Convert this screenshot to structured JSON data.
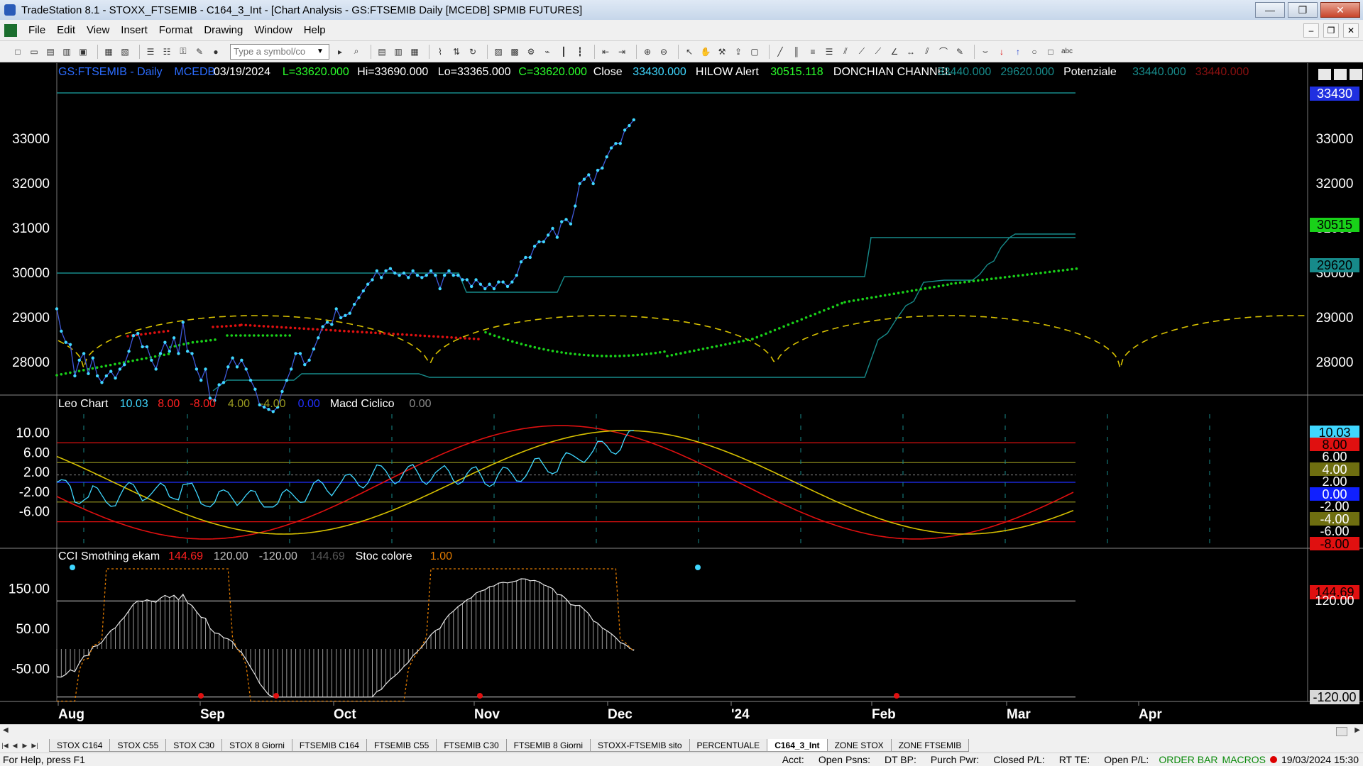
{
  "window": {
    "title": "TradeStation 8.1 - STOXX_FTSEMIB - C164_3_Int - [Chart Analysis - GS:FTSEMIB  Daily  [MCEDB] SPMIB FUTURES]",
    "minimize": "—",
    "maximize": "❐",
    "close": "✕"
  },
  "menu": {
    "items": [
      "File",
      "Edit",
      "View",
      "Insert",
      "Format",
      "Drawing",
      "Window",
      "Help"
    ]
  },
  "toolbar": {
    "symbol_placeholder": "Type a symbol/co"
  },
  "price_panel": {
    "header": [
      {
        "text": "GS:FTSEMIB - Daily",
        "color": "#2b6cff"
      },
      {
        "text": "MCEDB",
        "color": "#2b6cff"
      },
      {
        "text": "03/19/2024",
        "color": "#ffffff"
      },
      {
        "text": "L=33620.000",
        "color": "#2bff2b"
      },
      {
        "text": "Hi=33690.000",
        "color": "#ffffff"
      },
      {
        "text": "Lo=33365.000",
        "color": "#ffffff"
      },
      {
        "text": "C=33620.000",
        "color": "#2bff2b"
      },
      {
        "text": "Close",
        "color": "#ffffff"
      },
      {
        "text": "33430.000",
        "color": "#3fd7ff"
      },
      {
        "text": "HILOW Alert",
        "color": "#ffffff"
      },
      {
        "text": "30515.118",
        "color": "#2bff2b"
      },
      {
        "text": "DONCHIAN CHANNEL",
        "color": "#ffffff"
      },
      {
        "text": "33440.000",
        "color": "#178a8a"
      },
      {
        "text": "29620.000",
        "color": "#178a8a"
      },
      {
        "text": "Potenziale",
        "color": "#ffffff"
      },
      {
        "text": "33440.000",
        "color": "#178a8a"
      },
      {
        "text": "33440.000",
        "color": "#8a1010"
      }
    ],
    "y_ticks": [
      "33000",
      "32000",
      "31000",
      "30000",
      "29000",
      "28000"
    ],
    "y_tick_values": [
      33000,
      32000,
      31000,
      30000,
      29000,
      28000
    ],
    "badges": [
      {
        "text": "33430",
        "bg": "#1f2fe0",
        "fg": "#ffffff"
      },
      {
        "text": "30515",
        "bg": "#19d119",
        "fg": "#000000"
      },
      {
        "text": "29620",
        "bg": "#178a8a",
        "fg": "#000000"
      }
    ]
  },
  "leo_panel": {
    "header": [
      {
        "text": "Leo Chart",
        "color": "#ffffff"
      },
      {
        "text": "10.03",
        "color": "#3fd7ff"
      },
      {
        "text": "8.00",
        "color": "#ff2020"
      },
      {
        "text": "-8.00",
        "color": "#ff2020"
      },
      {
        "text": "4.00",
        "color": "#9a9a20"
      },
      {
        "text": "-4.00",
        "color": "#9a9a20"
      },
      {
        "text": "0.00",
        "color": "#2030ff"
      },
      {
        "text": "Macd Ciclico",
        "color": "#ffffff"
      },
      {
        "text": "0.00",
        "color": "#8a8a8a"
      }
    ],
    "y_ticks": [
      "10.00",
      "6.00",
      "2.00",
      "-2.00",
      "-6.00"
    ],
    "y_tick_values": [
      10,
      6,
      2,
      -2,
      -6
    ],
    "badges": [
      {
        "text": "10.03",
        "bg": "#3fd7ff",
        "fg": "#000000"
      },
      {
        "text": "8.00",
        "bg": "#e01010",
        "fg": "#000000"
      },
      {
        "text": "6.00",
        "bg": "",
        "fg": "#ffffff"
      },
      {
        "text": "4.00",
        "bg": "#6e6e10",
        "fg": "#ffffff"
      },
      {
        "text": "2.00",
        "bg": "",
        "fg": "#ffffff"
      },
      {
        "text": "0.00",
        "bg": "#1020ff",
        "fg": "#ffffff"
      },
      {
        "text": "-2.00",
        "bg": "",
        "fg": "#ffffff"
      },
      {
        "text": "-4.00",
        "bg": "#6e6e10",
        "fg": "#ffffff"
      },
      {
        "text": "-6.00",
        "bg": "",
        "fg": "#ffffff"
      },
      {
        "text": "-8.00",
        "bg": "#e01010",
        "fg": "#000000"
      }
    ]
  },
  "cci_panel": {
    "header": [
      {
        "text": "CCI Smothing ekam",
        "color": "#ffffff"
      },
      {
        "text": "144.69",
        "color": "#ff2020"
      },
      {
        "text": "120.00",
        "color": "#c0c0c0"
      },
      {
        "text": "-120.00",
        "color": "#c0c0c0"
      },
      {
        "text": "144.69",
        "color": "#555555"
      },
      {
        "text": "Stoc colore",
        "color": "#ffffff"
      },
      {
        "text": "1.00",
        "color": "#e07a00"
      }
    ],
    "y_ticks": [
      "150.00",
      "50.00",
      "-50.00"
    ],
    "y_tick_values": [
      150,
      50,
      -50
    ],
    "badges": [
      {
        "text": "144.69",
        "bg": "#e01010",
        "fg": "#000000"
      },
      {
        "text": "120.00",
        "bg": "",
        "fg": "#ffffff"
      },
      {
        "text": "-120.00",
        "bg": "#d8d8d8",
        "fg": "#000000"
      }
    ]
  },
  "x_axis": {
    "labels": [
      "Aug",
      "Sep",
      "Oct",
      "Nov",
      "Dec",
      "'24",
      "Feb",
      "Mar",
      "Apr"
    ]
  },
  "tabs": {
    "items": [
      "STOX C164",
      "STOX C55",
      "STOX  C30",
      "STOX  8 Giorni",
      "FTSEMIB C164",
      "FTSEMIB C55",
      "FTSEMIB C30",
      "FTSEMIB  8 Giorni",
      "STOXX-FTSEMIB sito",
      "PERCENTUALE",
      "C164_3_Int",
      "ZONE STOX",
      "ZONE FTSEMIB"
    ],
    "active": "C164_3_Int"
  },
  "status": {
    "help": "For Help, press F1",
    "acct": "Acct:",
    "open_psns": "Open Psns:",
    "dt_bp": "DT BP:",
    "purch_pwr": "Purch Pwr:",
    "closed_pl": "Closed P/L:",
    "rt_te": "RT TE:",
    "open_pl": "Open P/L:",
    "order_bar": "ORDER BAR",
    "macros": "MACROS",
    "datetime": "19/03/2024 15:30"
  },
  "colors": {
    "price": "#3fd7ff",
    "donchian": "#178a8a",
    "cycle": "#d6c000",
    "hilow_up": "#19d119",
    "hilow_down": "#e01010"
  },
  "chart_data": {
    "type": "line",
    "title": "GS:FTSEMIB - Daily",
    "price_close_series": {
      "name": "Close",
      "points": [
        [
          0,
          29200
        ],
        [
          1,
          28700
        ],
        [
          2,
          28450
        ],
        [
          3,
          28400
        ],
        [
          4,
          27700
        ],
        [
          5,
          28050
        ],
        [
          6,
          28200
        ],
        [
          7,
          27750
        ],
        [
          8,
          28100
        ],
        [
          9,
          27700
        ],
        [
          10,
          27550
        ],
        [
          11,
          27700
        ],
        [
          12,
          27800
        ],
        [
          13,
          27650
        ],
        [
          14,
          27850
        ],
        [
          15,
          27950
        ],
        [
          16,
          28250
        ],
        [
          17,
          28600
        ],
        [
          18,
          28650
        ],
        [
          19,
          28350
        ],
        [
          20,
          28350
        ],
        [
          21,
          28050
        ],
        [
          22,
          27850
        ],
        [
          23,
          28200
        ],
        [
          24,
          28450
        ],
        [
          25,
          28250
        ],
        [
          26,
          28550
        ],
        [
          27,
          28200
        ],
        [
          28,
          28900
        ],
        [
          29,
          28250
        ],
        [
          30,
          28200
        ],
        [
          31,
          27850
        ],
        [
          32,
          27600
        ],
        [
          33,
          27850
        ],
        [
          34,
          27200
        ],
        [
          35,
          27150
        ],
        [
          36,
          27500
        ],
        [
          37,
          27550
        ],
        [
          38,
          27900
        ],
        [
          39,
          28100
        ],
        [
          40,
          27900
        ],
        [
          41,
          28050
        ],
        [
          42,
          27850
        ],
        [
          43,
          27600
        ],
        [
          44,
          27400
        ],
        [
          45,
          27050
        ],
        [
          46,
          27000
        ],
        [
          47,
          26950
        ],
        [
          48,
          26900
        ],
        [
          49,
          27000
        ],
        [
          50,
          27350
        ],
        [
          51,
          27600
        ],
        [
          52,
          27850
        ],
        [
          53,
          28200
        ],
        [
          54,
          28200
        ],
        [
          55,
          27950
        ],
        [
          56,
          28050
        ],
        [
          57,
          28300
        ],
        [
          58,
          28550
        ],
        [
          59,
          28800
        ],
        [
          60,
          28900
        ],
        [
          61,
          28850
        ],
        [
          62,
          29200
        ],
        [
          63,
          29000
        ],
        [
          64,
          29050
        ],
        [
          65,
          29100
        ],
        [
          66,
          29300
        ],
        [
          67,
          29450
        ],
        [
          68,
          29600
        ],
        [
          69,
          29750
        ],
        [
          70,
          29850
        ],
        [
          71,
          30050
        ],
        [
          72,
          29900
        ],
        [
          73,
          30050
        ],
        [
          74,
          30100
        ],
        [
          75,
          30000
        ],
        [
          76,
          29950
        ],
        [
          77,
          30000
        ],
        [
          78,
          29900
        ],
        [
          79,
          30050
        ],
        [
          80,
          29950
        ],
        [
          81,
          29900
        ],
        [
          82,
          29950
        ],
        [
          83,
          30050
        ],
        [
          84,
          29950
        ],
        [
          85,
          29650
        ],
        [
          86,
          29950
        ],
        [
          87,
          30050
        ],
        [
          88,
          29950
        ],
        [
          89,
          29950
        ],
        [
          90,
          29850
        ],
        [
          91,
          29850
        ],
        [
          92,
          29700
        ],
        [
          93,
          29850
        ],
        [
          94,
          29750
        ],
        [
          95,
          29650
        ],
        [
          96,
          29750
        ],
        [
          97,
          29650
        ],
        [
          98,
          29800
        ],
        [
          99,
          29800
        ],
        [
          100,
          29700
        ],
        [
          101,
          29800
        ],
        [
          102,
          29950
        ],
        [
          103,
          30250
        ],
        [
          104,
          30350
        ],
        [
          105,
          30350
        ],
        [
          106,
          30600
        ],
        [
          107,
          30700
        ],
        [
          108,
          30700
        ],
        [
          109,
          30850
        ],
        [
          110,
          31000
        ],
        [
          111,
          30800
        ],
        [
          112,
          31150
        ],
        [
          113,
          31200
        ],
        [
          114,
          31100
        ],
        [
          115,
          31500
        ],
        [
          116,
          32000
        ],
        [
          117,
          32100
        ],
        [
          118,
          32200
        ],
        [
          119,
          32000
        ],
        [
          120,
          32300
        ],
        [
          121,
          32350
        ],
        [
          122,
          32600
        ],
        [
          123,
          32800
        ],
        [
          124,
          32900
        ],
        [
          125,
          32900
        ],
        [
          126,
          33200
        ],
        [
          127,
          33300
        ],
        [
          128,
          33430
        ]
      ]
    },
    "hilow_alert_last": 30515.118,
    "donchian_channel": {
      "upper": 33440,
      "lower": 29620
    },
    "leo_chart": {
      "value": 10.03,
      "levels": [
        8,
        -8,
        4,
        -4,
        0
      ]
    },
    "cci_smoothing": {
      "value": 144.69,
      "levels": [
        120,
        -120
      ]
    },
    "stoc_colore": 1.0,
    "x_labels": [
      "Aug",
      "Sep",
      "Oct",
      "Nov",
      "Dec",
      "'24",
      "Feb",
      "Mar",
      "Apr"
    ]
  }
}
